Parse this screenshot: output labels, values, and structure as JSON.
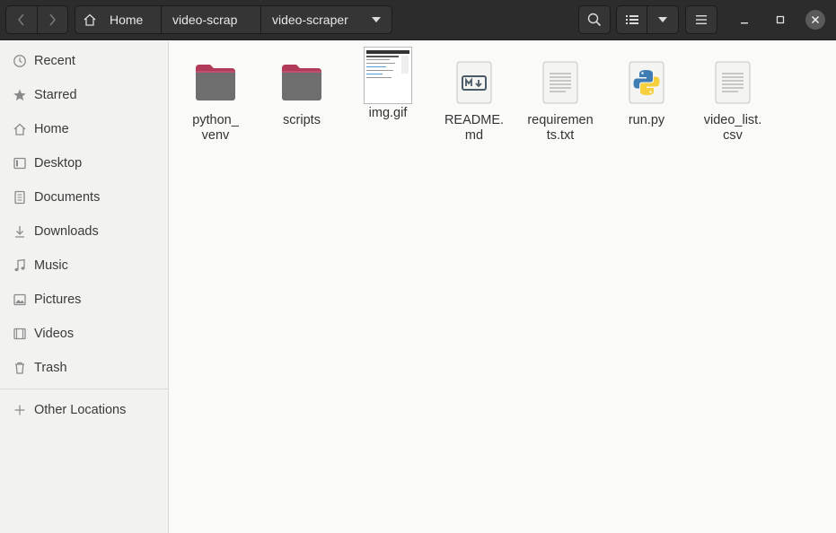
{
  "header": {
    "back_icon": "chevron-left-icon",
    "forward_icon": "chevron-right-icon",
    "breadcrumbs": [
      "Home",
      "video-scrap",
      "video-scraper"
    ],
    "search_icon": "search-icon",
    "view_icon": "list-view-icon",
    "menu_icon": "hamburger-menu-icon"
  },
  "sidebar": {
    "items": [
      {
        "label": "Recent",
        "icon": "clock-icon"
      },
      {
        "label": "Starred",
        "icon": "star-icon"
      },
      {
        "label": "Home",
        "icon": "home-icon"
      },
      {
        "label": "Desktop",
        "icon": "desktop-icon"
      },
      {
        "label": "Documents",
        "icon": "document-icon"
      },
      {
        "label": "Downloads",
        "icon": "download-icon"
      },
      {
        "label": "Music",
        "icon": "music-icon"
      },
      {
        "label": "Pictures",
        "icon": "picture-icon"
      },
      {
        "label": "Videos",
        "icon": "video-icon"
      },
      {
        "label": "Trash",
        "icon": "trash-icon"
      }
    ],
    "other_locations": "Other Locations"
  },
  "files": [
    {
      "name": "python_\nvenv",
      "type": "folder"
    },
    {
      "name": "scripts",
      "type": "folder"
    },
    {
      "name": "img.gif",
      "type": "image"
    },
    {
      "name": "README.\nmd",
      "type": "markdown"
    },
    {
      "name": "requiremen\nts.txt",
      "type": "text"
    },
    {
      "name": "run.py",
      "type": "python"
    },
    {
      "name": "video_list.\ncsv",
      "type": "text"
    }
  ],
  "colors": {
    "headerbar": "#2c2c2c",
    "sidebar": "#f2f2f0",
    "folder_tab": "#b03a58",
    "folder_body": "#6e6e6e"
  }
}
